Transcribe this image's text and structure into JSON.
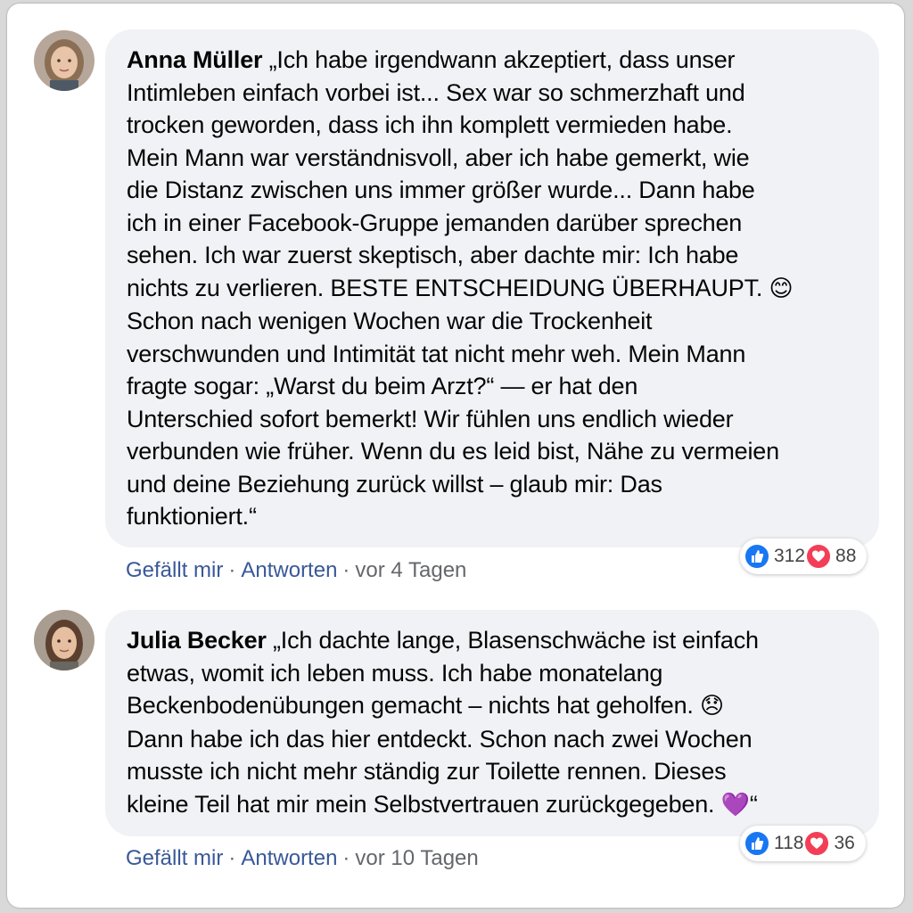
{
  "colors": {
    "link": "#385898",
    "bubble": "#f0f2f5",
    "meta": "#65676b",
    "like": "#1877f2",
    "love": "#f33e58"
  },
  "comments": [
    {
      "author": "Anna Müller",
      "text_lines": [
        "„Ich habe irgendwann akzeptiert, dass unser",
        "Intimleben einfach vorbei ist... Sex war so schmerzhaft und",
        "trocken geworden, dass ich ihn komplett vermieden habe.",
        "Mein Mann war verständnisvoll, aber ich habe gemerkt, wie",
        "die Distanz zwischen uns immer größer wurde... Dann habe",
        "ich in einer Facebook-Gruppe jemanden darüber sprechen",
        "sehen. Ich war zuerst skeptisch, aber dachte mir: Ich habe",
        "nichts zu verlieren. BESTE ENTSCHEIDUNG ÜBERHAUPT.",
        "Schon nach wenigen Wochen war die Trockenheit",
        "verschwunden und Intimität tat nicht mehr weh. Mein Mann",
        "fragte sogar: „Warst du beim Arzt?“ — er hat den",
        "Unterschied sofort bemerkt! Wir fühlen uns endlich wieder",
        "verbunden wie früher. Wenn du es leid bist, Nähe zu vermeien",
        "und deine Beziehung zurück willst – glaub mir: Das",
        "funktioniert.“"
      ],
      "emoji": "😊",
      "like_label": "Gefällt mir",
      "reply_label": "Antworten",
      "time": "vor 4 Tagen",
      "likes": "312",
      "loves": "88"
    },
    {
      "author": "Julia Becker",
      "text_lines": [
        "„Ich dachte lange, Blasenschwäche ist einfach",
        "etwas, womit ich leben muss. Ich habe monatelang",
        "Beckenbodenübungen gemacht – nichts hat geholfen.",
        "Dann habe ich das hier entdeckt. Schon nach zwei Wochen",
        "musste ich nicht mehr ständig zur Toilette rennen. Dieses",
        "kleine Teil hat mir mein Selbstvertrauen zurückgegeben."
      ],
      "emoji": "😞",
      "closing_emoji": "💜",
      "closing_quote": "“",
      "like_label": "Gefällt mir",
      "reply_label": "Antworten",
      "time": "vor 10 Tagen",
      "likes": "118",
      "loves": "36"
    }
  ]
}
